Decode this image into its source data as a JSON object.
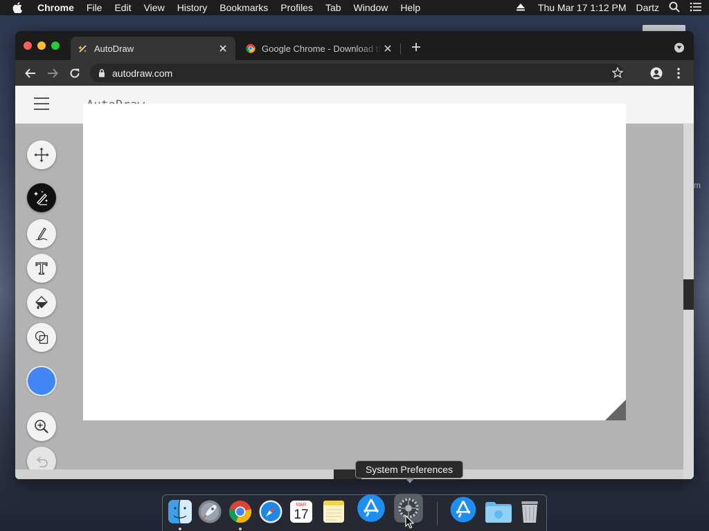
{
  "menubar": {
    "app_name": "Chrome",
    "items": [
      "File",
      "Edit",
      "View",
      "History",
      "Bookmarks",
      "Profiles",
      "Tab",
      "Window",
      "Help"
    ],
    "clock": "Thu Mar 17  1:12 PM",
    "user": "Dartz",
    "icons": [
      "apple-icon",
      "eject-icon",
      "search-icon",
      "control-center-icon"
    ]
  },
  "browser": {
    "tabs": [
      {
        "title": "AutoDraw",
        "favicon": "autodraw-favicon",
        "active": true
      },
      {
        "title": "Google Chrome - Download the Fast, Secure Browser from Google",
        "favicon": "chrome-favicon",
        "active": false
      }
    ],
    "address": "autodraw.com"
  },
  "app": {
    "title": "AutoDraw",
    "tools": [
      "select-move",
      "autodraw",
      "draw",
      "type",
      "fill",
      "shape",
      "color",
      "zoom",
      "undo"
    ],
    "selected_tool": "autodraw",
    "selected_color": "#4285f4"
  },
  "tooltip": {
    "text": "System Preferences"
  },
  "dock": {
    "apps": [
      "Finder",
      "Launchpad",
      "Google Chrome",
      "Safari",
      "Calendar",
      "Notes",
      "App Store",
      "System Preferences",
      "App Store",
      "Downloads",
      "Trash"
    ],
    "calendar_month": "MAR",
    "calendar_day": "17"
  }
}
